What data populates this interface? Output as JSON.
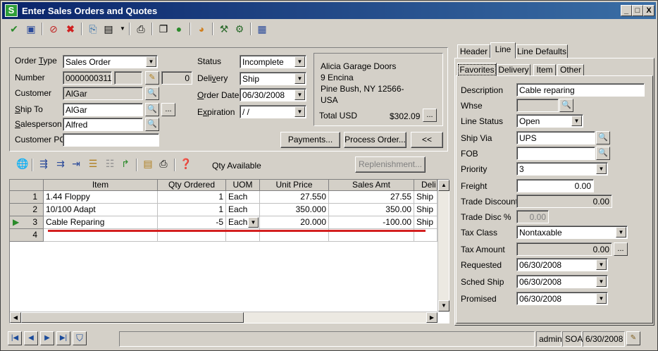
{
  "window": {
    "title": "Enter Sales Orders and Quotes",
    "icon_letter": "S",
    "min": "_",
    "max": "□",
    "close": "X"
  },
  "header_fields": {
    "order_type": {
      "label_pre": "Order ",
      "label_ul": "T",
      "label_post": "ype",
      "value": "Sales Order"
    },
    "number": {
      "label": "Number",
      "value": "0000000311",
      "count": "0"
    },
    "customer": {
      "label": "Customer",
      "value": "AlGar"
    },
    "ship_to": {
      "label_ul": "S",
      "label_post": "hip To",
      "value": "AlGar"
    },
    "salesperson": {
      "label_ul": "S",
      "label_post": "alesperson",
      "value": "Alfred"
    },
    "customer_po": {
      "label": "Customer PO",
      "value": ""
    },
    "status": {
      "label": "Status",
      "value": "Incomplete"
    },
    "delivery": {
      "label_pre": "Deli",
      "label_ul": "v",
      "label_post": "ery",
      "value": "Ship"
    },
    "order_date": {
      "label_ul": "O",
      "label_post": "rder Date",
      "value": "06/30/2008"
    },
    "expiration": {
      "label_pre": "E",
      "label_ul": "x",
      "label_post": "piration",
      "value": " /  /"
    }
  },
  "address": {
    "line1": "Alicia Garage Doors",
    "line2": "9 Encina",
    "line3": "Pine Bush, NY  12566-",
    "line4": "USA",
    "total_label": "Total  USD",
    "total_value": "$302.09"
  },
  "buttons": {
    "payments": "Payments...",
    "process_order": "Process Order...",
    "collapse": "<<",
    "replenishment": "Replenishment...",
    "ellipsis": "..."
  },
  "line_toolbar": {
    "qty_available": "Qty Available"
  },
  "grid": {
    "columns": [
      "Item",
      "Qty Ordered",
      "UOM",
      "Unit Price",
      "Sales Amt",
      "Deli"
    ],
    "rows": [
      {
        "num": "1",
        "item": "1.44 Floppy",
        "qty": "1",
        "uom": "Each",
        "price": "27.550",
        "amt": "27.55",
        "deli": "Ship"
      },
      {
        "num": "2",
        "item": "10/100 Adapt",
        "qty": "1",
        "uom": "Each",
        "price": "350.000",
        "amt": "350.00",
        "deli": "Ship"
      },
      {
        "num": "3",
        "item": "Cable Reparing",
        "qty": "-5",
        "uom": "Each",
        "price": "20.000",
        "amt": "-100.00",
        "deli": "Ship"
      },
      {
        "num": "4",
        "item": "",
        "qty": "",
        "uom": "",
        "price": "",
        "amt": "",
        "deli": ""
      }
    ]
  },
  "tabs_top": [
    "Header",
    "Line",
    "Line Defaults"
  ],
  "tabs_sub": [
    "Favorites",
    "Delivery",
    "Item",
    "Other"
  ],
  "line_detail": {
    "description": {
      "label": "Description",
      "value": "Cable reparing"
    },
    "whse": {
      "label": "Whse",
      "value": ""
    },
    "line_status": {
      "label": "Line Status",
      "value": "Open"
    },
    "ship_via": {
      "label": "Ship Via",
      "value": "UPS"
    },
    "fob": {
      "label": "FOB",
      "value": ""
    },
    "priority": {
      "label": "Priority",
      "value": "3"
    },
    "freight": {
      "label": "Freight",
      "value": "0.00"
    },
    "trade_discount": {
      "label": "Trade Discount",
      "value": "0.00"
    },
    "trade_disc_pct": {
      "label": "Trade Disc %",
      "value": "0.00"
    },
    "tax_class": {
      "label": "Tax Class",
      "value": "Nontaxable"
    },
    "tax_amount": {
      "label": "Tax Amount",
      "value": "0.00"
    },
    "requested": {
      "label": "Requested",
      "value": "06/30/2008"
    },
    "sched_ship": {
      "label": "Sched Ship",
      "value": "06/30/2008"
    },
    "promised": {
      "label": "Promised",
      "value": "06/30/2008"
    }
  },
  "statusbar": {
    "user": "admin",
    "module": "SOA",
    "date": "6/30/2008"
  },
  "colors": {
    "title_start": "#0a246a",
    "title_end": "#3a6ea5",
    "red_line": "#d42020"
  }
}
